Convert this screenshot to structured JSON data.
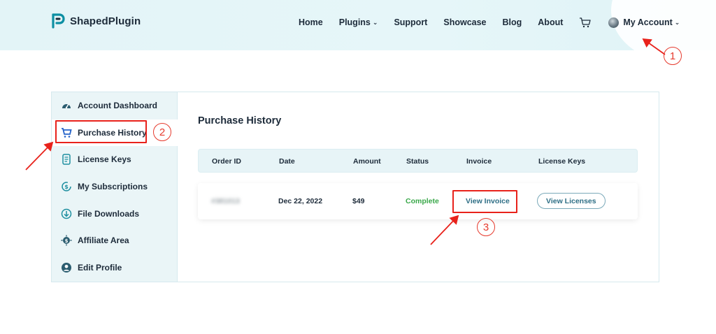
{
  "brand": {
    "name": "ShapedPlugin",
    "accent": "#0d8fa3"
  },
  "nav": {
    "items": [
      {
        "label": "Home"
      },
      {
        "label": "Plugins",
        "has_dropdown": true
      },
      {
        "label": "Support"
      },
      {
        "label": "Showcase"
      },
      {
        "label": "Blog"
      },
      {
        "label": "About"
      }
    ],
    "cart_icon": "cart-icon",
    "account": {
      "label": "My Account",
      "has_dropdown": true
    }
  },
  "sidebar": {
    "items": [
      {
        "label": "Account Dashboard",
        "icon": "gauge-icon"
      },
      {
        "label": "Purchase History",
        "icon": "cart-icon",
        "active": true
      },
      {
        "label": "License Keys",
        "icon": "license-icon"
      },
      {
        "label": "My Subscriptions",
        "icon": "subscription-icon"
      },
      {
        "label": "File Downloads",
        "icon": "download-icon"
      },
      {
        "label": "Affiliate Area",
        "icon": "affiliate-icon"
      },
      {
        "label": "Edit Profile",
        "icon": "profile-icon"
      }
    ]
  },
  "main": {
    "title": "Purchase History",
    "columns": [
      "Order ID",
      "Date",
      "Amount",
      "Status",
      "Invoice",
      "License Keys"
    ],
    "rows": [
      {
        "order_id": "#381013",
        "date": "Dec 22, 2022",
        "amount": "$49",
        "status": "Complete",
        "invoice_label": "View Invoice",
        "license_label": "View Licenses"
      }
    ]
  },
  "annotations": {
    "step1": "1",
    "step2": "2",
    "step3": "3",
    "color": "#e63b2e"
  },
  "colors": {
    "status_complete": "#3aa84a",
    "link": "#2f6f86"
  }
}
